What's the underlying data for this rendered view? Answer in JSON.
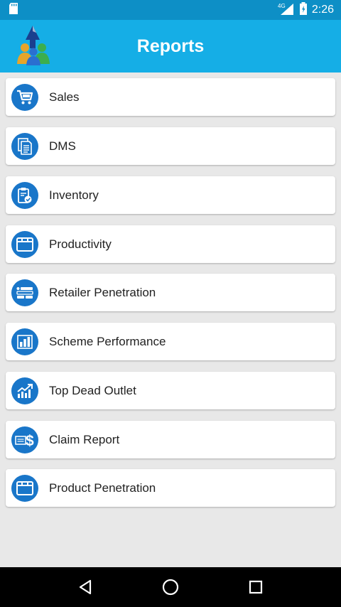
{
  "status_bar": {
    "network": "4G",
    "time": "2:26"
  },
  "app_bar": {
    "title": "Reports"
  },
  "reports": [
    {
      "label": "Sales",
      "icon": "cart-icon"
    },
    {
      "label": "DMS",
      "icon": "document-icon"
    },
    {
      "label": "Inventory",
      "icon": "clipboard-check-icon"
    },
    {
      "label": "Productivity",
      "icon": "window-icon"
    },
    {
      "label": "Retailer Penetration",
      "icon": "list-icon"
    },
    {
      "label": "Scheme Performance",
      "icon": "bar-chart-icon"
    },
    {
      "label": "Top Dead Outlet",
      "icon": "trend-up-icon"
    },
    {
      "label": "Claim Report",
      "icon": "money-icon"
    },
    {
      "label": "Product Penetration",
      "icon": "window-icon"
    }
  ],
  "colors": {
    "status_bar": "#0d8fc6",
    "app_bar": "#15aee6",
    "icon_circle": "#1976c9",
    "background": "#e8e8e8"
  }
}
